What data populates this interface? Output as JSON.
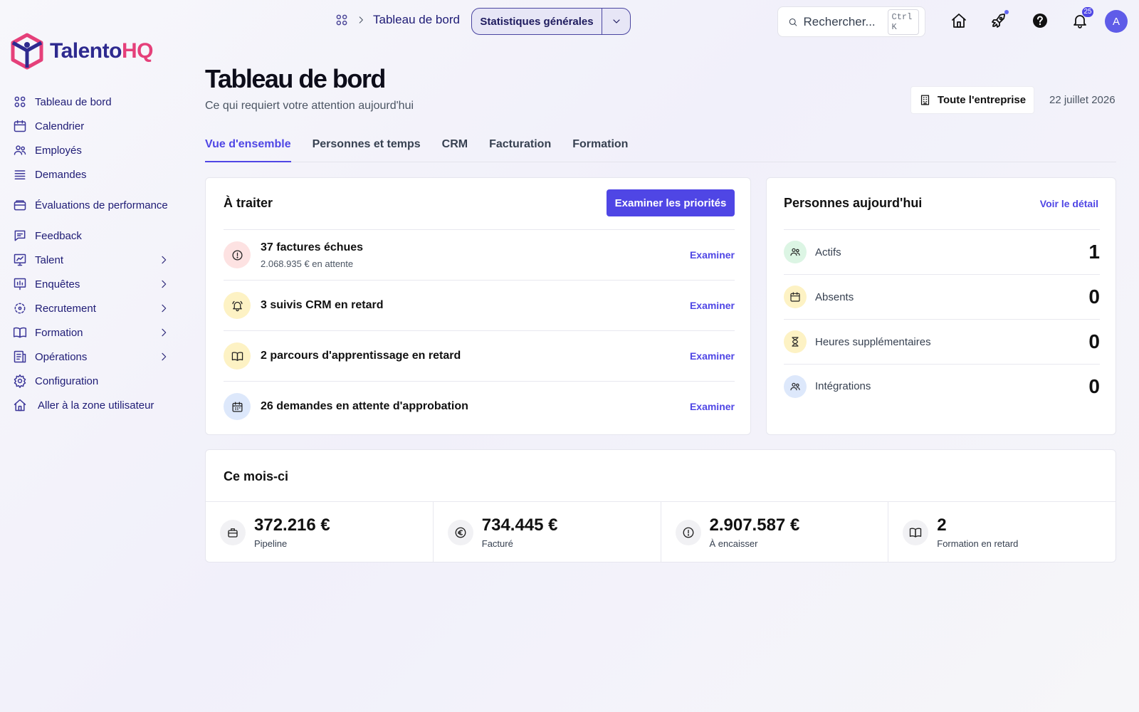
{
  "brand": {
    "name_part1": "Talento",
    "name_part2": "HQ",
    "color_primary": "#2e2a8f",
    "color_accent": "#e5407a"
  },
  "sidebar": {
    "items": [
      {
        "label": "Tableau de bord",
        "icon": "dashboard-icon"
      },
      {
        "label": "Calendrier",
        "icon": "calendar-icon"
      },
      {
        "label": "Employés",
        "icon": "users-icon"
      },
      {
        "label": "Demandes",
        "icon": "list-icon"
      },
      {
        "label": "Évaluations de performance",
        "icon": "folder-icon"
      },
      {
        "label": "Feedback",
        "icon": "message-icon"
      },
      {
        "label": "Talent",
        "icon": "chart-icon"
      },
      {
        "label": "Enquêtes",
        "icon": "survey-icon"
      },
      {
        "label": "Recrutement",
        "icon": "target-icon"
      },
      {
        "label": "Formation",
        "icon": "book-icon"
      },
      {
        "label": "Opérations",
        "icon": "operations-icon"
      },
      {
        "label": "Configuration",
        "icon": "gear-icon"
      },
      {
        "label": "Aller à la zone utilisateur",
        "icon": "home-icon"
      }
    ]
  },
  "topbar": {
    "breadcrumb": "Tableau de bord",
    "view_selector": "Statistiques générales",
    "search_placeholder": "Rechercher...",
    "search_shortcut": "Ctrl K",
    "notifications_count": "25",
    "avatar_initial": "A",
    "accent_color": "#4f46e5"
  },
  "header": {
    "title": "Tableau de bord",
    "subtitle": "Ce qui requiert votre attention aujourd'hui",
    "scope": "Toute l'entreprise",
    "date": "22 juillet 2026"
  },
  "tabs": [
    {
      "label": "Vue d'ensemble",
      "active": true
    },
    {
      "label": "Personnes et temps",
      "active": false
    },
    {
      "label": "CRM",
      "active": false
    },
    {
      "label": "Facturation",
      "active": false
    },
    {
      "label": "Formation",
      "active": false
    }
  ],
  "todo": {
    "title": "À traiter",
    "button": "Examiner les priorités",
    "items": [
      {
        "title": "37 factures échues",
        "detail": "2.068.935 € en attente",
        "action": "Examiner",
        "icon": "alert-icon"
      },
      {
        "title": "3 suivis CRM en retard",
        "detail": "",
        "action": "Examiner",
        "icon": "bell-icon"
      },
      {
        "title": "2 parcours d'apprentissage en retard",
        "detail": "",
        "action": "Examiner",
        "icon": "book-icon"
      },
      {
        "title": "26 demandes en attente d'approbation",
        "detail": "",
        "action": "Examiner",
        "icon": "calendar-icon"
      }
    ]
  },
  "people": {
    "title": "Personnes aujourd'hui",
    "link": "Voir le détail",
    "rows": [
      {
        "label": "Actifs",
        "value": "1",
        "icon": "users-icon"
      },
      {
        "label": "Absents",
        "value": "0",
        "icon": "calendar-icon"
      },
      {
        "label": "Heures supplémentaires",
        "value": "0",
        "icon": "hourglass-icon"
      },
      {
        "label": "Intégrations",
        "value": "0",
        "icon": "users-icon"
      }
    ]
  },
  "month": {
    "title": "Ce mois-ci",
    "kpis": [
      {
        "value": "372.216 €",
        "label": "Pipeline",
        "icon": "briefcase-icon"
      },
      {
        "value": "734.445 €",
        "label": "Facturé",
        "icon": "euro-icon"
      },
      {
        "value": "2.907.587 €",
        "label": "À encaisser",
        "icon": "alert-icon"
      },
      {
        "value": "2",
        "label": "Formation en retard",
        "icon": "book-icon"
      }
    ]
  }
}
